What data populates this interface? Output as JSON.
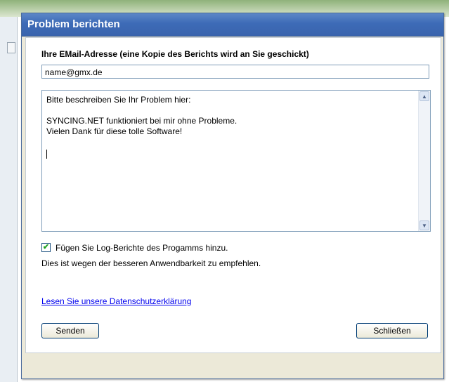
{
  "dialog": {
    "title": "Problem berichten",
    "email_label": "Ihre EMail-Adresse (eine Kopie des Berichts wird an Sie geschickt)",
    "email_value": "name@gmx.de",
    "description": "Bitte beschreiben Sie Ihr Problem hier:\n\nSYNCING.NET funktioniert bei mir ohne Probleme.\nVielen Dank für diese tolle Software!",
    "log_checkbox_label": "Fügen Sie Log-Berichte des Progamms hinzu.",
    "log_checkbox_checked": true,
    "hint": "Dies ist wegen der besseren Anwendbarkeit zu empfehlen.",
    "privacy_link": "Lesen Sie unsere Datenschutzerklärung",
    "send_button": "Senden",
    "close_button": "Schließen"
  },
  "icons": {
    "checkmark": "✔",
    "scroll_up": "▲",
    "scroll_down": "▼"
  },
  "colors": {
    "titlebar": "#3d6bb7",
    "dialog_bg": "#ece9d8",
    "link": "#0000ee",
    "check": "#21a121"
  }
}
